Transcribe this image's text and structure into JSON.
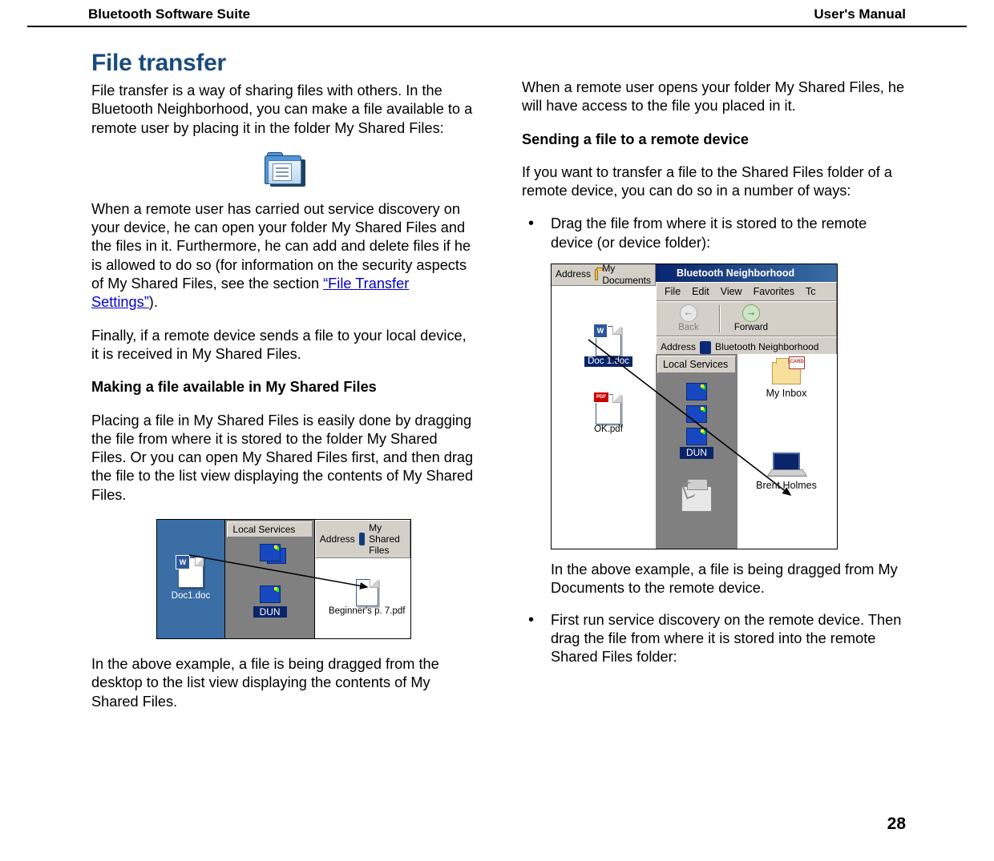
{
  "header": {
    "left": "Bluetooth Software Suite",
    "right": "User's Manual"
  },
  "page_number": "28",
  "section_title": "File transfer",
  "left_column": {
    "p1": "File transfer is a way of sharing files with others. In the Bluetooth Neighborhood, you can make a file available to a remote user by placing it in the folder My Shared Files:",
    "p2_pre": "When a remote user has carried out service discovery on your device, he can open your folder My Shared Files and the files in it. Furthermore, he can add and delete files if he is allowed to do so (for information on the security aspects of My Shared Files, see the section ",
    "p2_link": "“File Transfer Settings”",
    "p2_post": ").",
    "p3": "Finally, if a remote device sends a file to your local device, it is received in My Shared Files.",
    "h2a": "Making a file available in My Shared Files",
    "p4": "Placing a file in My Shared Files is easily done by dragging the file from where it is stored to the folder My Shared Files. Or you can open My Shared Files first, and then drag the file to the list view displaying the contents of My Shared Files.",
    "p5": "In the above example, a file is being dragged from the desktop to the list view displaying the contents of My Shared Files."
  },
  "figure2": {
    "desktop_file": "Doc1.doc",
    "local_services_label": "Local Services",
    "dun_label": "DUN",
    "address_label": "Address",
    "address_value": "My Shared Files",
    "list_file": "Beginner's p. 7.pdf"
  },
  "right_column": {
    "p1": "When a remote user opens your folder My Shared Files, he will have access to the file you placed in it.",
    "h2a": "Sending a file to a remote device",
    "p2": "If you want to transfer a file to the Shared Files folder of a remote device, you can do so in a number of ways:",
    "li1": "Drag the file from where it is stored to the remote device (or device folder):",
    "li1_after": "In the above example, a file is being dragged from My Documents to the remote device.",
    "li2": "First run service discovery on the remote device. Then drag the file from where it is stored into the remote Shared Files folder:"
  },
  "figure3": {
    "outer_address_label": "Address",
    "outer_address_value": "My Documents",
    "window_title": "Bluetooth Neighborhood",
    "menu": {
      "file": "File",
      "edit": "Edit",
      "view": "View",
      "favorites": "Favorites",
      "tools_initial": "Tc"
    },
    "back_label": "Back",
    "forward_label": "Forward",
    "inner_address_label": "Address",
    "inner_address_value": "Bluetooth Neighborhood",
    "local_services_label": "Local Services",
    "dun_label": "DUN",
    "left_file1": "Doc 1.doc",
    "left_file2": "OK.pdf",
    "device1": "My Inbox",
    "device2": "Brent Holmes"
  }
}
